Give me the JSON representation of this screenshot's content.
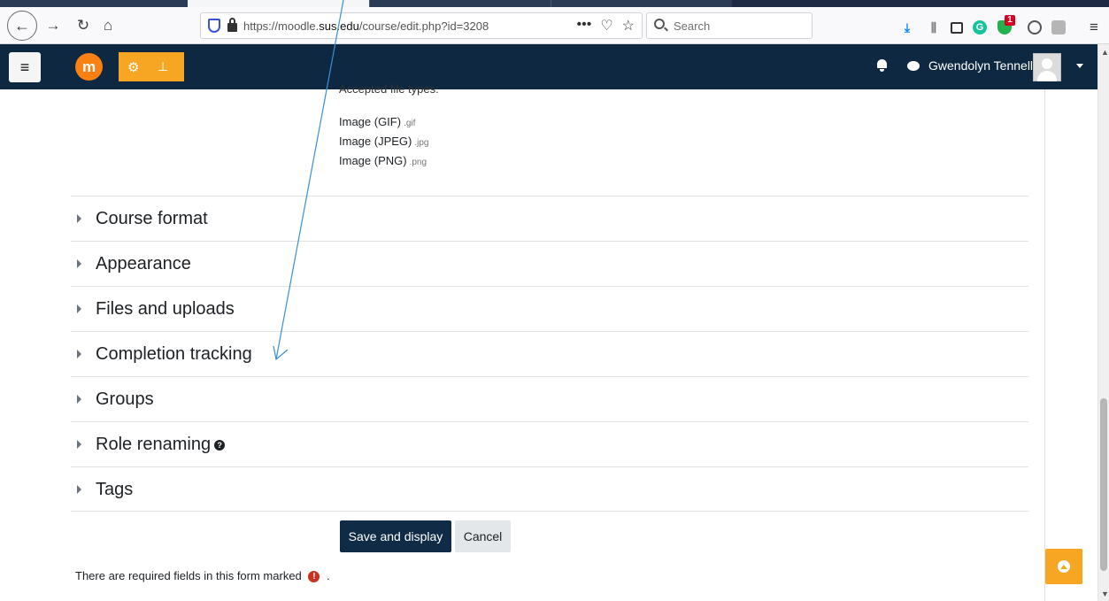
{
  "browser": {
    "url_prefix": "https://moodle.",
    "url_domain": "sus.edu",
    "url_path": "/course/edit.php?id=3208",
    "url_actions": [
      "•••",
      "♡",
      "☆"
    ],
    "search_placeholder": "Search",
    "extension_badge": "1"
  },
  "navbar": {
    "user_name": "Gwendolyn Tennell"
  },
  "filepicker": {
    "label": "Accepted file types:",
    "types": [
      {
        "name": "Image (GIF)",
        "ext": ".gif"
      },
      {
        "name": "Image (JPEG)",
        "ext": ".jpg"
      },
      {
        "name": "Image (PNG)",
        "ext": ".png"
      }
    ]
  },
  "sections": [
    {
      "label": "Course format"
    },
    {
      "label": "Appearance"
    },
    {
      "label": "Files and uploads"
    },
    {
      "label": "Completion tracking"
    },
    {
      "label": "Groups"
    },
    {
      "label": "Role renaming"
    },
    {
      "label": "Tags"
    }
  ],
  "buttons": {
    "save": "Save and display",
    "cancel": "Cancel"
  },
  "required_note": {
    "text": "There are required fields in this form marked",
    "suffix": "."
  },
  "colors": {
    "navbar": "#0d2840",
    "accent": "#f6a623",
    "moodle_orange": "#f98012",
    "primary_button": "#0f2b46",
    "required": "#ca3120",
    "annotation_arrow": "#3b8fd9"
  }
}
